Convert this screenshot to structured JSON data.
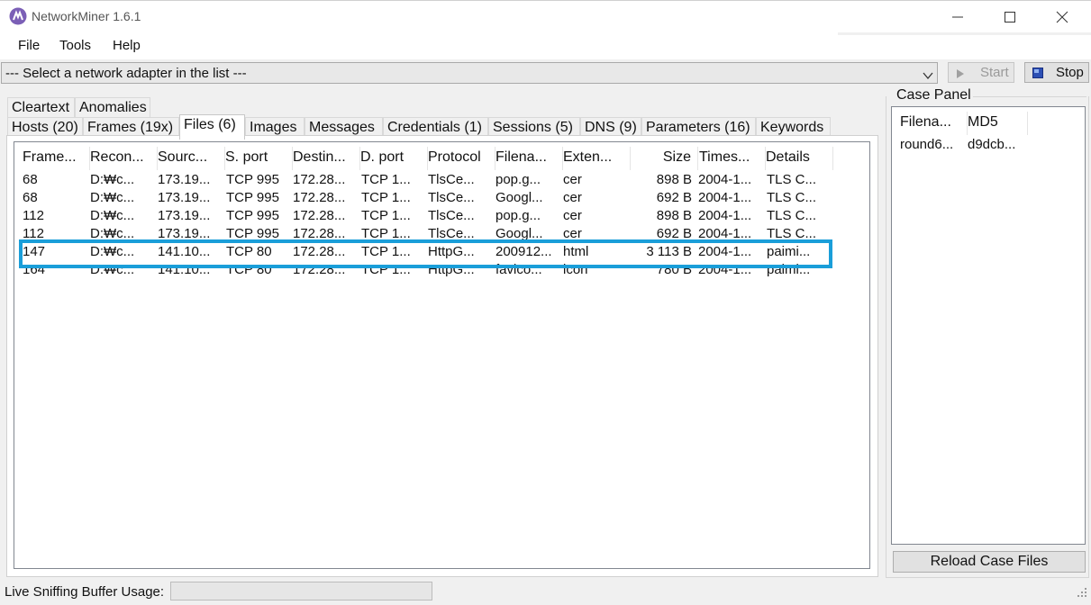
{
  "window": {
    "title": "NetworkMiner 1.6.1"
  },
  "menu": [
    "File",
    "Tools",
    "Help"
  ],
  "toolbar": {
    "adapter_text": "--- Select a network adapter in the list ---",
    "start_label": "Start",
    "stop_label": "Stop"
  },
  "tabs_row1": [
    "Cleartext",
    "Anomalies"
  ],
  "tabs_row2": [
    "Hosts (20)",
    "Frames (19x)",
    "Files (6)",
    "Images",
    "Messages",
    "Credentials (1)",
    "Sessions (5)",
    "DNS (9)",
    "Parameters (16)",
    "Keywords"
  ],
  "active_tab": "Files (6)",
  "files_table": {
    "columns": [
      "Frame...",
      "Recon...",
      "Sourc...",
      "S. port",
      "Destin...",
      "D. port",
      "Protocol",
      "Filena...",
      "Exten...",
      "Size",
      "Times...",
      "Details"
    ],
    "rows": [
      [
        "68",
        "D:₩c...",
        "173.19...",
        "TCP 995",
        "172.28...",
        "TCP 1...",
        "TlsCe...",
        "pop.g...",
        "cer",
        "898 B",
        "2004-1...",
        "TLS C..."
      ],
      [
        "68",
        "D:₩c...",
        "173.19...",
        "TCP 995",
        "172.28...",
        "TCP 1...",
        "TlsCe...",
        "Googl...",
        "cer",
        "692 B",
        "2004-1...",
        "TLS C..."
      ],
      [
        "112",
        "D:₩c...",
        "173.19...",
        "TCP 995",
        "172.28...",
        "TCP 1...",
        "TlsCe...",
        "pop.g...",
        "cer",
        "898 B",
        "2004-1...",
        "TLS C..."
      ],
      [
        "112",
        "D:₩c...",
        "173.19...",
        "TCP 995",
        "172.28...",
        "TCP 1...",
        "TlsCe...",
        "Googl...",
        "cer",
        "692 B",
        "2004-1...",
        "TLS C..."
      ],
      [
        "147",
        "D:₩c...",
        "141.10...",
        "TCP 80",
        "172.28...",
        "TCP 1...",
        "HttpG...",
        "200912...",
        "html",
        "3 113 B",
        "2004-1...",
        "paimi..."
      ],
      [
        "164",
        "D:₩c...",
        "141.10...",
        "TCP 80",
        "172.28...",
        "TCP 1...",
        "HttpG...",
        "favico...",
        "icon",
        "780 B",
        "2004-1...",
        "paimi..."
      ]
    ],
    "highlighted_row": 4
  },
  "case_panel": {
    "label": "Case Panel",
    "columns": [
      "Filena...",
      "MD5"
    ],
    "rows": [
      [
        "round6...",
        "d9dcb..."
      ]
    ],
    "reload_label": "Reload Case Files"
  },
  "status": {
    "label": "Live Sniffing Buffer Usage:"
  },
  "colors": {
    "highlight": "#1a9ed9",
    "app_icon": "#7b5fb6"
  }
}
